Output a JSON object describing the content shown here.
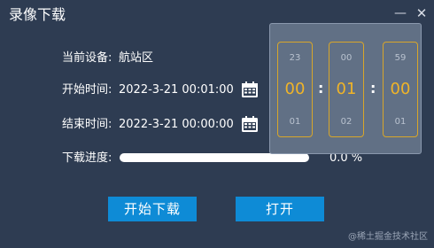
{
  "window": {
    "title": "录像下载"
  },
  "device": {
    "label": "当前设备:",
    "value": "航站区"
  },
  "start_time": {
    "label": "开始时间:",
    "value": "2022-3-21 00:01:00"
  },
  "end_time": {
    "label": "结束时间:",
    "value": "2022-3-21 00:00:00"
  },
  "progress": {
    "label": "下载进度:",
    "fraction": 0.0,
    "percent_text": "0.0 %"
  },
  "buttons": {
    "download": "开始下载",
    "open": "打开"
  },
  "time_picker": {
    "hour": {
      "prev": "23",
      "current": "00",
      "next": "01"
    },
    "minute": {
      "prev": "00",
      "current": "01",
      "next": "02"
    },
    "second": {
      "prev": "59",
      "current": "00",
      "next": "01"
    },
    "separator": ":"
  },
  "watermark": "@稀土掘金技术社区",
  "colors": {
    "background": "#2e3c52",
    "button": "#0e8bd6",
    "picker_accent": "#f0b428",
    "picker_border": "#d8a62a"
  },
  "icons": {
    "calendar": "calendar-icon",
    "minimize": "minimize-icon",
    "close": "close-icon"
  }
}
